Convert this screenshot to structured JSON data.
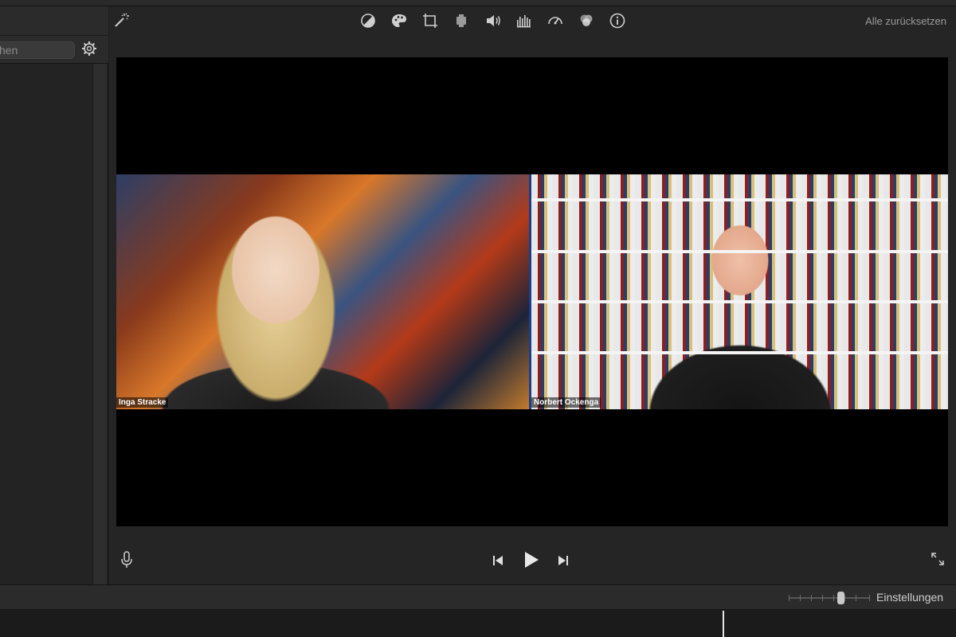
{
  "left_panel": {
    "search": {
      "placeholder": "Suchen",
      "visible_text": "hen"
    }
  },
  "viewer": {
    "toolbar": {
      "tools": [
        {
          "name": "color-balance-icon"
        },
        {
          "name": "color-correction-icon"
        },
        {
          "name": "crop-icon"
        },
        {
          "name": "stabilization-icon"
        },
        {
          "name": "volume-icon"
        },
        {
          "name": "noise-reduction-equalizer-icon"
        },
        {
          "name": "speed-icon"
        },
        {
          "name": "clip-filter-icon"
        },
        {
          "name": "info-icon"
        }
      ],
      "reset_label": "Alle zurücksetzen"
    },
    "video": {
      "left_participant": "Inga Stracke",
      "right_participant": "Norbert Ockenga"
    },
    "controls": {
      "mic": "microphone-icon",
      "prev": "skip-back-icon",
      "play": "play-icon",
      "next": "skip-forward-icon",
      "fullscreen": "fullscreen-icon"
    }
  },
  "bottom_bar": {
    "zoom_level": 0.66,
    "settings_label": "Einstellungen"
  },
  "colors": {
    "background": "#1e1e1e",
    "panel": "#262626",
    "text": "#d0d0d0",
    "muted_text": "#9a9a9a",
    "video_divider": "#1c3c8c"
  }
}
